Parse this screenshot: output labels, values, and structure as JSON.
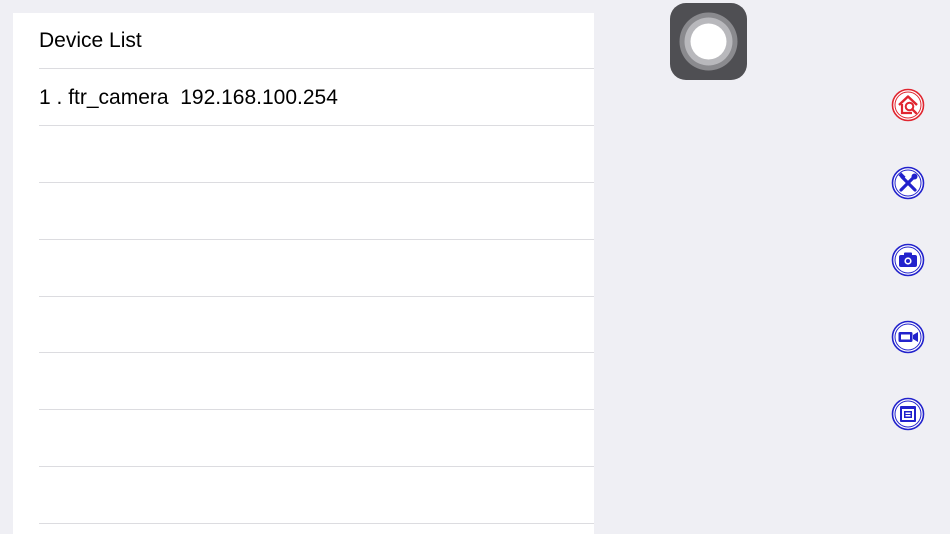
{
  "device_list": {
    "header": "Device List",
    "devices": [
      {
        "index": "1 .",
        "name": "ftr_camera",
        "ip": "192.168.100.254"
      }
    ],
    "empty_rows": 7
  },
  "side_toolbar": {
    "buttons": [
      {
        "name": "home-search",
        "color": "#e0252f"
      },
      {
        "name": "tools",
        "color": "#2222cc"
      },
      {
        "name": "camera",
        "color": "#2222cc"
      },
      {
        "name": "video",
        "color": "#2222cc"
      },
      {
        "name": "album",
        "color": "#2222cc"
      }
    ]
  },
  "colors": {
    "background": "#efeff4",
    "panel": "#ffffff",
    "separator": "#dcdce0",
    "assistive_touch": "#4f4f53"
  }
}
